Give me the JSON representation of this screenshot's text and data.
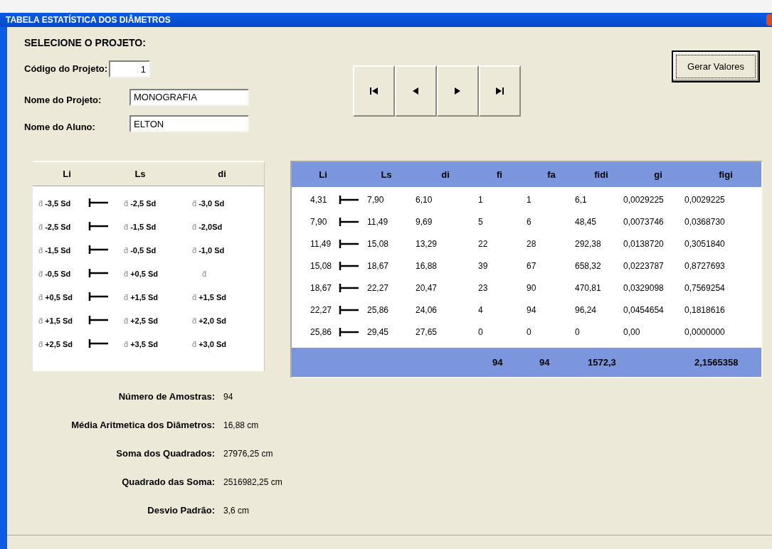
{
  "window": {
    "title": "TABELA ESTATÍSTICA DOS DIÂMETROS"
  },
  "project": {
    "heading": "SELECIONE O PROJETO:",
    "fields": [
      {
        "label": "Código do Projeto:",
        "value": "1",
        "kind": "number"
      },
      {
        "label": "Nome do Projeto:",
        "value": "MONOGRAFIA",
        "kind": "text"
      },
      {
        "label": "Nome do Aluno:",
        "value": "ELTON",
        "kind": "text"
      }
    ]
  },
  "navigation": {
    "buttons": [
      {
        "kind": "first"
      },
      {
        "kind": "prev"
      },
      {
        "kind": "next"
      },
      {
        "kind": "last"
      }
    ]
  },
  "generate_button": "Gerar Valores",
  "formula_table": {
    "columns": [
      "Li",
      "Ls",
      "di"
    ],
    "rows": [
      {
        "li": [
          "d̄",
          "-3,5 Sd"
        ],
        "ls": [
          "d̄",
          "-2,5 Sd"
        ],
        "di": [
          "d̄",
          "-3,0 Sd"
        ]
      },
      {
        "li": [
          "d̄",
          "-2,5 Sd"
        ],
        "ls": [
          "d̄",
          "-1,5 Sd"
        ],
        "di": [
          "d̄",
          "-2,0Sd"
        ]
      },
      {
        "li": [
          "d̄",
          "-1,5 Sd"
        ],
        "ls": [
          "d̄",
          "-0,5 Sd"
        ],
        "di": [
          "d̄",
          "-1,0 Sd"
        ]
      },
      {
        "li": [
          "d̄",
          "-0,5 Sd"
        ],
        "ls": [
          "d̄",
          "+0,5 Sd"
        ],
        "di": [
          "d̄"
        ]
      },
      {
        "li": [
          "d̄",
          "+0,5 Sd"
        ],
        "ls": [
          "d̄",
          "+1,5 Sd"
        ],
        "di": [
          "d̄",
          "+1,5 Sd"
        ]
      },
      {
        "li": [
          "d̄",
          "+1,5 Sd"
        ],
        "ls": [
          "d̄",
          "+2,5 Sd"
        ],
        "di": [
          "d̄",
          "+2,0 Sd"
        ]
      },
      {
        "li": [
          "d̄",
          "+2,5 Sd"
        ],
        "ls": [
          "d̄",
          "+3,5 Sd"
        ],
        "di": [
          "d̄",
          "+3,0 Sd"
        ]
      }
    ]
  },
  "value_table": {
    "columns": [
      "Li",
      "Ls",
      "di",
      "fi",
      "fa",
      "fidi",
      "gi",
      "figi"
    ],
    "rows": [
      [
        "4,31",
        "7,90",
        "6,10",
        "1",
        "1",
        "6,1",
        "0,0029225",
        "0,0029225"
      ],
      [
        "7,90",
        "11,49",
        "9,69",
        "5",
        "6",
        "48,45",
        "0,0073746",
        "0,0368730"
      ],
      [
        "11,49",
        "15,08",
        "13,29",
        "22",
        "28",
        "292,38",
        "0,0138720",
        "0,3051840"
      ],
      [
        "15,08",
        "18,67",
        "16,88",
        "39",
        "67",
        "658,32",
        "0,0223787",
        "0,8727693"
      ],
      [
        "18,67",
        "22,27",
        "20,47",
        "23",
        "90",
        "470,81",
        "0,0329098",
        "0,7569254"
      ],
      [
        "22,27",
        "25,86",
        "24,06",
        "4",
        "94",
        "96,24",
        "0,0454654",
        "0,1818616"
      ],
      [
        "25,86",
        "29,45",
        "27,65",
        "0",
        "0",
        "0",
        "0,00",
        "0,0000000"
      ]
    ],
    "totals": {
      "fi": "94",
      "fa": "94",
      "fidi": "1572,3",
      "figi": "2,1565358"
    }
  },
  "statistics": [
    {
      "label": "Número de Amostras:",
      "value": "94"
    },
    {
      "label": "Média Aritmetica dos Diâmetros:",
      "value": "16,88 cm"
    },
    {
      "label": "Soma dos Quadrados:",
      "value": "27976,25 cm"
    },
    {
      "label": "Quadrado das Soma:",
      "value": "2516982,25 cm"
    },
    {
      "label": "Desvio Padrão:",
      "value": "3,6 cm"
    }
  ]
}
